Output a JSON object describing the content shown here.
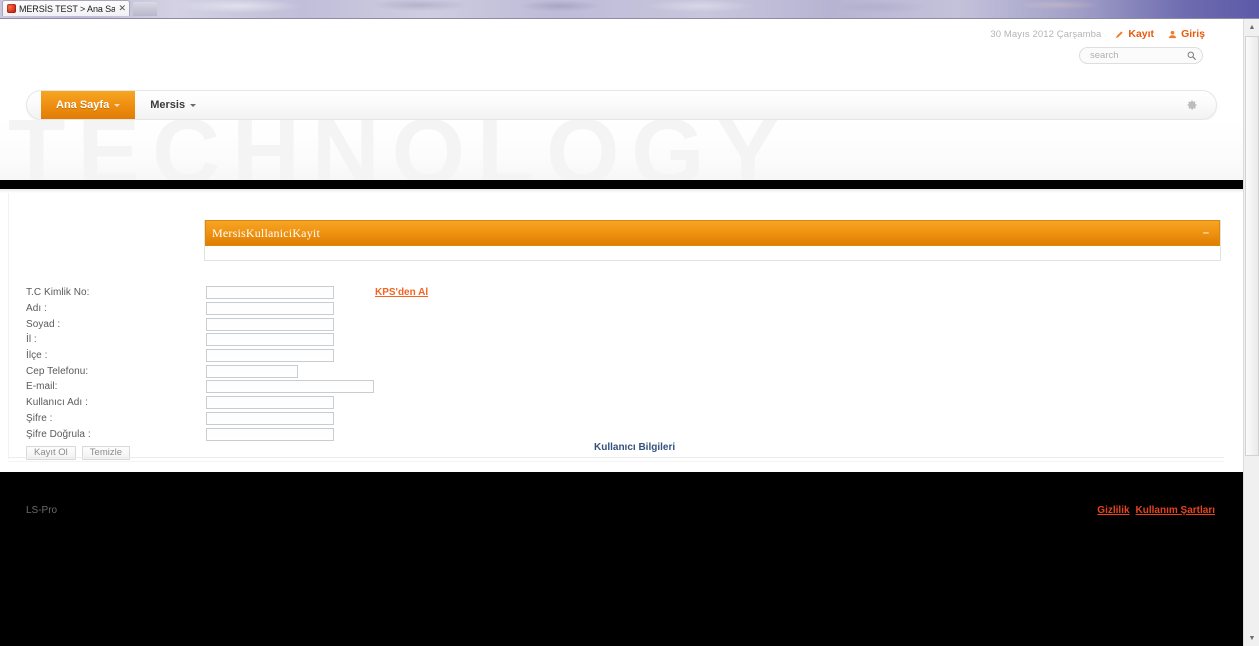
{
  "browser": {
    "tab_title": "MERSİS TEST > Ana Sayfa >...",
    "tab_close": "✕",
    "favicon": "site-favicon-icon"
  },
  "header": {
    "date": "30 Mayıs 2012 Çarşamba",
    "register_label": "Kayıt",
    "login_label": "Giriş",
    "register_icon": "pencil-icon",
    "login_icon": "user-icon"
  },
  "search": {
    "placeholder": "search",
    "value": "",
    "icon": "search-icon"
  },
  "nav": {
    "items": [
      {
        "label": "Ana Sayfa",
        "active": true
      },
      {
        "label": "Mersis",
        "active": false
      }
    ],
    "gear_icon": "gear-icon"
  },
  "hero": {
    "watermark": "TECHNOLOGY"
  },
  "panel": {
    "title": "MersisKullaniciKayit",
    "collapse_label": "–",
    "collapse_icon": "minimize-icon"
  },
  "form": {
    "heading": "Kullanıcı Bilgileri",
    "kps_link": "KPS'den Al",
    "fields": [
      {
        "label": "T.C Kimlik No:",
        "value": "",
        "size": "std"
      },
      {
        "label": "Adı :",
        "value": "",
        "size": "std"
      },
      {
        "label": "Soyad :",
        "value": "",
        "size": "std"
      },
      {
        "label": "İl :",
        "value": "",
        "size": "std"
      },
      {
        "label": "İlçe :",
        "value": "",
        "size": "std"
      },
      {
        "label": "Cep Telefonu:",
        "value": "",
        "size": "sm"
      },
      {
        "label": "E-mail:",
        "value": "",
        "size": "lg"
      },
      {
        "label": "Kullanıcı Adı :",
        "value": "",
        "size": "std"
      },
      {
        "label": "Şifre :",
        "value": "",
        "size": "std"
      },
      {
        "label": "Şifre Doğrula :",
        "value": "",
        "size": "std"
      }
    ],
    "submit_label": "Kayıt Ol",
    "clear_label": "Temizle"
  },
  "footer": {
    "brand": "LS-Pro",
    "privacy_label": "Gizlilik",
    "terms_label": "Kullanım Şartları"
  },
  "colors": {
    "accent_orange": "#ef8f11",
    "link_orange": "#f26522",
    "heading_blue": "#33517d",
    "footer_link": "#e8431c",
    "footer_bg": "#000000"
  }
}
